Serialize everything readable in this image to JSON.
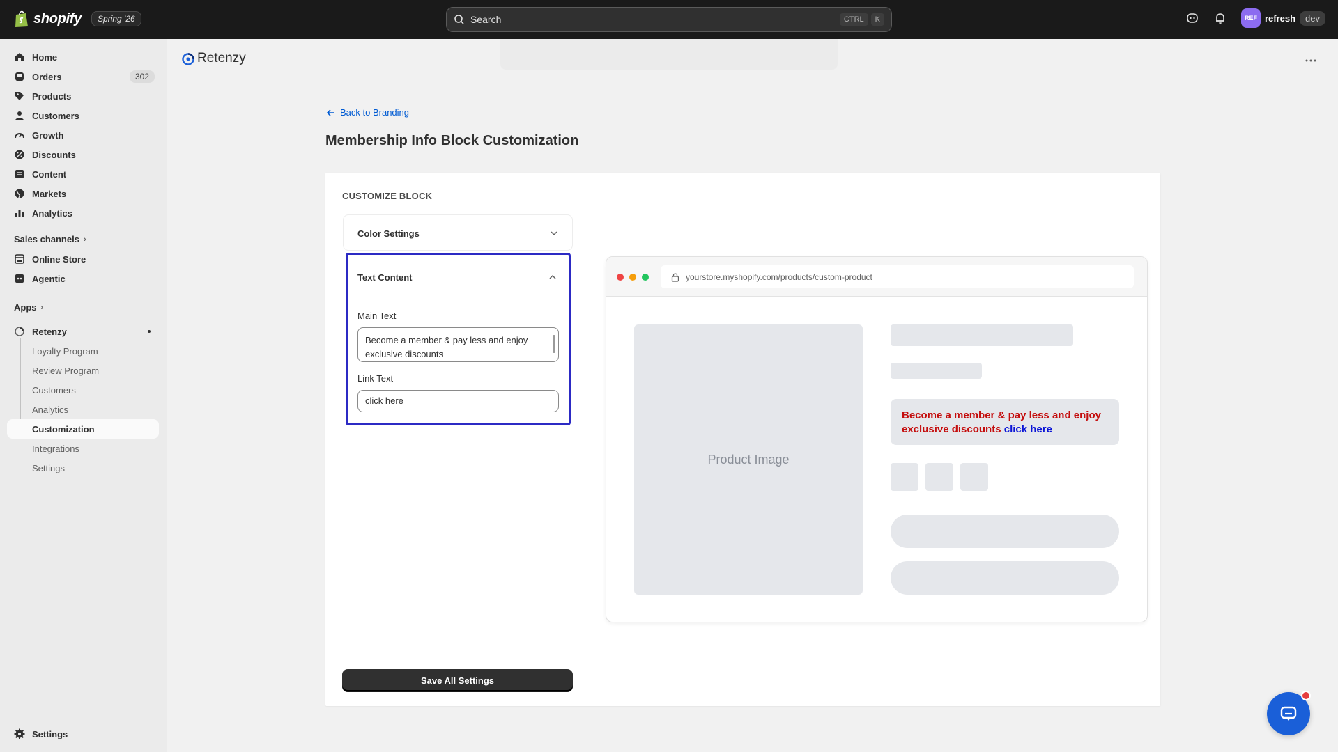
{
  "topbar": {
    "brand": "shopify",
    "edition": "Spring '26",
    "search_placeholder": "Search",
    "shortcut_ctrl": "CTRL",
    "shortcut_key": "K",
    "user_initials": "REF",
    "user_name": "refresh",
    "user_badge": "dev"
  },
  "sidebar": {
    "items": [
      {
        "label": "Home"
      },
      {
        "label": "Orders",
        "count": "302"
      },
      {
        "label": "Products"
      },
      {
        "label": "Customers"
      },
      {
        "label": "Growth"
      },
      {
        "label": "Discounts"
      },
      {
        "label": "Content"
      },
      {
        "label": "Markets"
      },
      {
        "label": "Analytics"
      }
    ],
    "sales_channels_label": "Sales channels",
    "channels": [
      {
        "label": "Online Store"
      },
      {
        "label": "Agentic"
      }
    ],
    "apps_label": "Apps",
    "app_name": "Retenzy",
    "app_sub_items": [
      {
        "label": "Loyalty Program"
      },
      {
        "label": "Review Program"
      },
      {
        "label": "Customers"
      },
      {
        "label": "Analytics"
      },
      {
        "label": "Customization"
      },
      {
        "label": "Integrations"
      },
      {
        "label": "Settings"
      }
    ],
    "settings_label": "Settings"
  },
  "app_header": {
    "title": "Retenzy"
  },
  "page": {
    "back_link": "Back to Branding",
    "title": "Membership Info Block Customization"
  },
  "customize": {
    "heading": "CUSTOMIZE BLOCK",
    "color_settings_label": "Color Settings",
    "text_content_label": "Text Content",
    "main_text_label": "Main Text",
    "main_text_value": "Become a member & pay less and enjoy exclusive discounts",
    "link_text_label": "Link Text",
    "link_text_value": "click here",
    "save_label": "Save All Settings"
  },
  "preview": {
    "url": "yourstore.myshopify.com/products/custom-product",
    "product_image_label": "Product Image",
    "member_text": "Become a member & pay less and enjoy exclusive discounts",
    "member_link": "click here",
    "main_text_color": "#c40c0c",
    "link_color": "#0a14d6"
  },
  "colors": {
    "accent_blue": "#005bd3",
    "focus_border": "#2c2ac4",
    "chat_blue": "#1a5fd8"
  }
}
